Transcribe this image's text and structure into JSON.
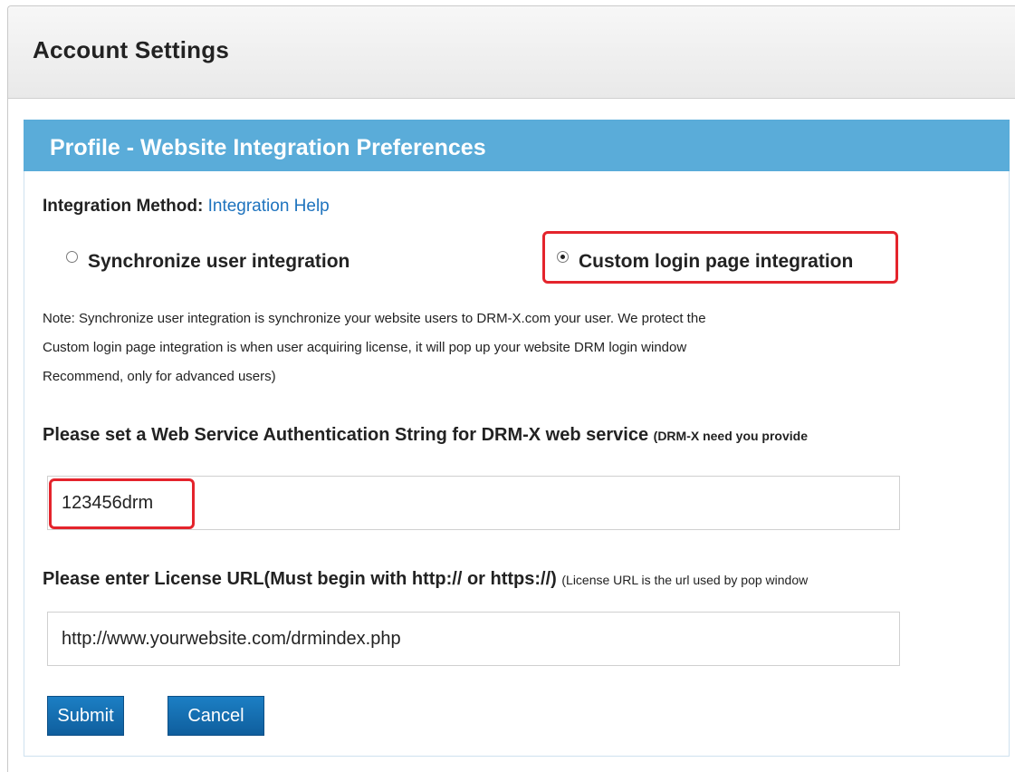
{
  "header": {
    "title": "Account Settings"
  },
  "panel": {
    "title": "Profile - Website Integration Preferences"
  },
  "integration": {
    "label": "Integration Method:",
    "help_link": "Integration Help",
    "options": [
      {
        "label": "Synchronize user integration",
        "checked": false
      },
      {
        "label": "Custom login page integration",
        "checked": true
      }
    ],
    "note_lines": [
      "Note: Synchronize user integration is synchronize your website users to DRM-X.com your user. We protect the",
      "Custom login page integration is when user acquiring license, it will pop up your website DRM login window",
      "Recommend, only for advanced users)"
    ]
  },
  "auth": {
    "label": "Please set a Web Service Authentication String for DRM-X web service",
    "label_suffix": "(DRM-X need you provide",
    "value": "123456drm"
  },
  "license_url": {
    "label": "Please enter License URL(Must begin with http:// or https://)",
    "label_suffix": "(License URL is the url used by pop window",
    "value": "http://www.yourwebsite.com/drmindex.php"
  },
  "buttons": {
    "submit": "Submit",
    "cancel": "Cancel"
  },
  "colors": {
    "panel_header": "#5aacd9",
    "button": "#1570b5",
    "highlight": "#e4242c",
    "link": "#1e73be"
  }
}
